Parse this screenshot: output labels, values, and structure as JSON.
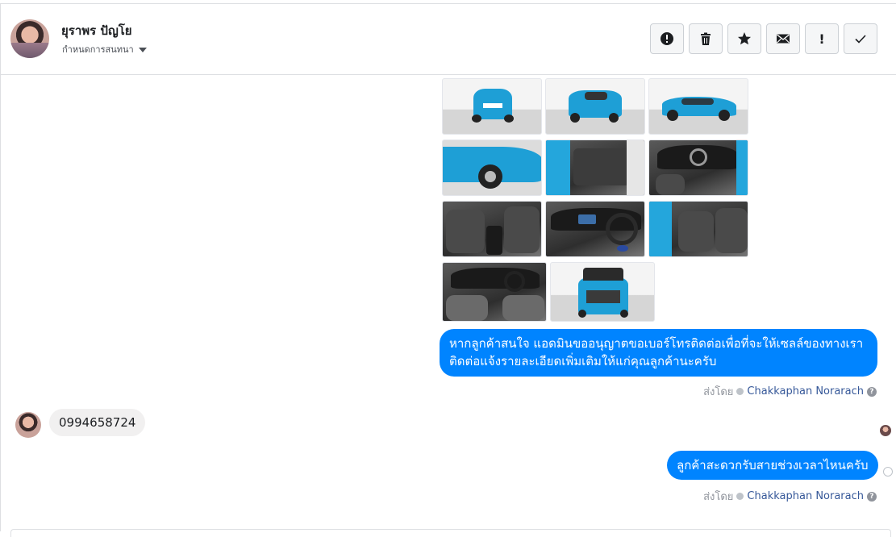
{
  "header": {
    "contact_name": "ยุราพร ปัญโย",
    "assign_label": "กำหนดการสนทนา",
    "actions": [
      {
        "name": "report-spam-button",
        "icon": "alert-circle-icon",
        "label": ""
      },
      {
        "name": "delete-button",
        "icon": "trash-icon",
        "label": ""
      },
      {
        "name": "star-button",
        "icon": "star-icon",
        "label": ""
      },
      {
        "name": "mark-unread-button",
        "icon": "envelope-icon",
        "label": ""
      },
      {
        "name": "follow-up-button",
        "icon": "exclamation-icon",
        "label": "!"
      },
      {
        "name": "mark-done-button",
        "icon": "checkmark-icon",
        "label": ""
      }
    ]
  },
  "photos": [
    "car-rear-view",
    "car-rear-quarter-view",
    "car-side-view",
    "car-front-wheel-view",
    "car-door-interior-view",
    "car-dashboard-view",
    "car-center-console-view",
    "car-steering-wheel-view",
    "car-rear-seat-view",
    "car-cabin-wide-view",
    "car-trunk-open-view"
  ],
  "messages": {
    "outgoing_1": "หากลูกค้าสนใจ แอดมินขออนุญาตขอเบอร์โทรติดต่อเพื่อที่จะให้เซลล์ของทางเราติดต่อแจ้งรายละเอียดเพิ่มเติมให้แก่คุณลูกค้านะครับ",
    "incoming_1": "0994658724",
    "outgoing_2": "ลูกค้าสะดวกรับสายช่วงเวลาไหนครับ"
  },
  "sent_by": {
    "prefix": "ส่งโดย",
    "agent_name": "Chakkaphan Norarach",
    "help": "?"
  },
  "colors": {
    "outgoing_bubble": "#0084ff",
    "incoming_bubble": "#f1f0f0",
    "agent_link": "#365899",
    "car_blue": "#1e9fd6"
  }
}
